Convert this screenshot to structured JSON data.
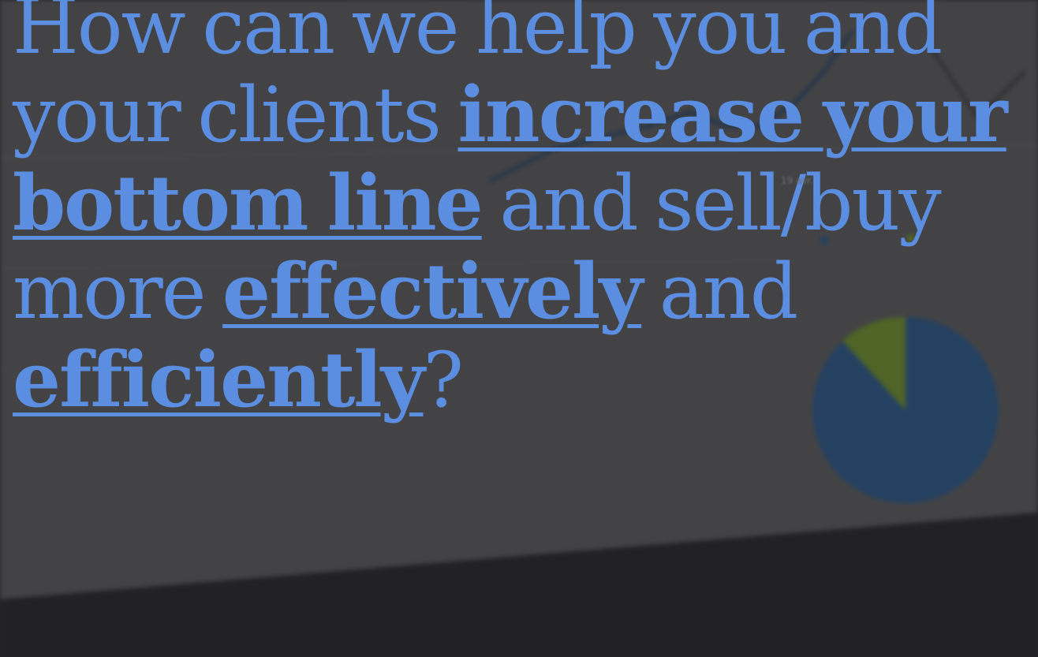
{
  "headline": {
    "part1": "How can we help you and your clients ",
    "emphasis1": "increase your bottom line",
    "part2": " and sell/buy more ",
    "emphasis2": "effectively",
    "part3": " and ",
    "emphasis3": "efficiently",
    "part4": "?"
  },
  "background": {
    "chart_label": "19 avr.",
    "dock_icons": [
      "app-icon",
      "app-icon",
      "app-icon",
      "photo-icon",
      "music-icon",
      "spotify-icon",
      "trash-icon"
    ]
  },
  "colors": {
    "headline": "#5b8ee0",
    "background": "#2c2c2e",
    "pie_primary": "#2f5a8a",
    "pie_secondary": "#6f8f2e"
  }
}
